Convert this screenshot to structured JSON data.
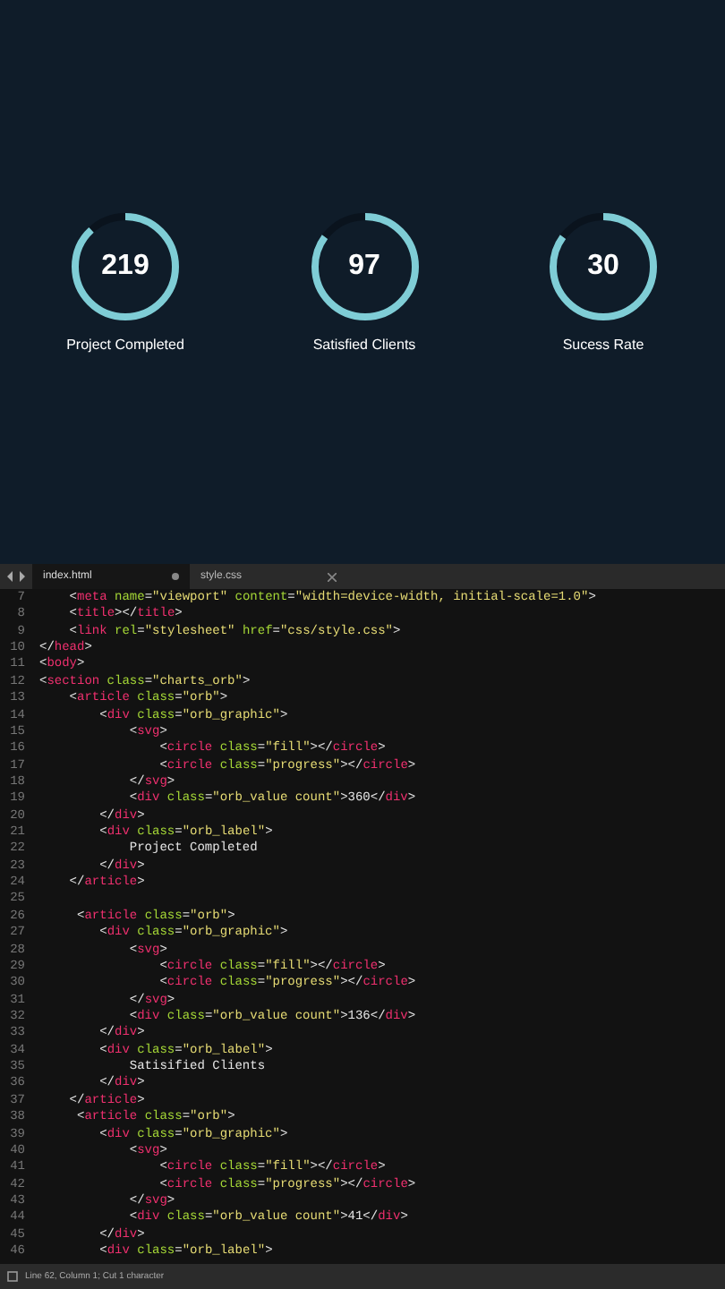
{
  "orbs": [
    {
      "value": "219",
      "label": "Project Completed",
      "level": 0.88
    },
    {
      "value": "97",
      "label": "Satisfied Clients",
      "level": 0.85
    },
    {
      "value": "30",
      "label": "Sucess Rate",
      "level": 0.85
    }
  ],
  "editor": {
    "tabs": [
      {
        "label": "index.html",
        "selected": true,
        "modified": true
      },
      {
        "label": "style.css",
        "selected": false,
        "modified": false
      }
    ],
    "lines": [
      {
        "number": "7",
        "tokens": [
          {
            "kind": "punct",
            "text": "    <"
          },
          {
            "kind": "tag",
            "text": "meta"
          },
          {
            "kind": "attr",
            "text": " name"
          },
          {
            "kind": "punct",
            "text": "="
          },
          {
            "kind": "string",
            "text": "\"viewport\""
          },
          {
            "kind": "attr",
            "text": " content"
          },
          {
            "kind": "punct",
            "text": "="
          },
          {
            "kind": "string",
            "text": "\"width=device-width, initial-scale=1.0\""
          },
          {
            "kind": "punct",
            "text": ">"
          }
        ]
      },
      {
        "number": "8",
        "tokens": [
          {
            "kind": "punct",
            "text": "    <"
          },
          {
            "kind": "tag",
            "text": "title"
          },
          {
            "kind": "punct",
            "text": "></"
          },
          {
            "kind": "tag",
            "text": "title"
          },
          {
            "kind": "punct",
            "text": ">"
          }
        ]
      },
      {
        "number": "9",
        "tokens": [
          {
            "kind": "punct",
            "text": "    <"
          },
          {
            "kind": "tag",
            "text": "link"
          },
          {
            "kind": "attr",
            "text": " rel"
          },
          {
            "kind": "punct",
            "text": "="
          },
          {
            "kind": "string",
            "text": "\"stylesheet\""
          },
          {
            "kind": "attr",
            "text": " href"
          },
          {
            "kind": "punct",
            "text": "="
          },
          {
            "kind": "string",
            "text": "\"css/style.css\""
          },
          {
            "kind": "punct",
            "text": ">"
          }
        ]
      },
      {
        "number": "10",
        "tokens": [
          {
            "kind": "punct",
            "text": "</"
          },
          {
            "kind": "tag",
            "text": "head"
          },
          {
            "kind": "punct",
            "text": ">"
          }
        ]
      },
      {
        "number": "11",
        "tokens": [
          {
            "kind": "punct",
            "text": "<"
          },
          {
            "kind": "tag",
            "text": "body"
          },
          {
            "kind": "punct",
            "text": ">"
          }
        ]
      },
      {
        "number": "12",
        "tokens": [
          {
            "kind": "punct",
            "text": "<"
          },
          {
            "kind": "tag",
            "text": "section"
          },
          {
            "kind": "attr",
            "text": " class"
          },
          {
            "kind": "punct",
            "text": "="
          },
          {
            "kind": "string",
            "text": "\"charts_orb\""
          },
          {
            "kind": "punct",
            "text": ">"
          }
        ]
      },
      {
        "number": "13",
        "tokens": [
          {
            "kind": "punct",
            "text": "    <"
          },
          {
            "kind": "tag",
            "text": "article"
          },
          {
            "kind": "attr",
            "text": " class"
          },
          {
            "kind": "punct",
            "text": "="
          },
          {
            "kind": "string",
            "text": "\"orb\""
          },
          {
            "kind": "punct",
            "text": ">"
          }
        ]
      },
      {
        "number": "14",
        "tokens": [
          {
            "kind": "punct",
            "text": "        <"
          },
          {
            "kind": "tag",
            "text": "div"
          },
          {
            "kind": "attr",
            "text": " class"
          },
          {
            "kind": "punct",
            "text": "="
          },
          {
            "kind": "string",
            "text": "\"orb_graphic\""
          },
          {
            "kind": "punct",
            "text": ">"
          }
        ]
      },
      {
        "number": "15",
        "tokens": [
          {
            "kind": "punct",
            "text": "            <"
          },
          {
            "kind": "tag",
            "text": "svg"
          },
          {
            "kind": "punct",
            "text": ">"
          }
        ]
      },
      {
        "number": "16",
        "tokens": [
          {
            "kind": "punct",
            "text": "                <"
          },
          {
            "kind": "tag",
            "text": "circle"
          },
          {
            "kind": "attr",
            "text": " class"
          },
          {
            "kind": "punct",
            "text": "="
          },
          {
            "kind": "string",
            "text": "\"fill\""
          },
          {
            "kind": "punct",
            "text": "></"
          },
          {
            "kind": "tag",
            "text": "circle"
          },
          {
            "kind": "punct",
            "text": ">"
          }
        ]
      },
      {
        "number": "17",
        "tokens": [
          {
            "kind": "punct",
            "text": "                <"
          },
          {
            "kind": "tag",
            "text": "circle"
          },
          {
            "kind": "attr",
            "text": " class"
          },
          {
            "kind": "punct",
            "text": "="
          },
          {
            "kind": "string",
            "text": "\"progress\""
          },
          {
            "kind": "punct",
            "text": "></"
          },
          {
            "kind": "tag",
            "text": "circle"
          },
          {
            "kind": "punct",
            "text": ">"
          }
        ]
      },
      {
        "number": "18",
        "tokens": [
          {
            "kind": "punct",
            "text": "            </"
          },
          {
            "kind": "tag",
            "text": "svg"
          },
          {
            "kind": "punct",
            "text": ">"
          }
        ]
      },
      {
        "number": "19",
        "tokens": [
          {
            "kind": "punct",
            "text": "            <"
          },
          {
            "kind": "tag",
            "text": "div"
          },
          {
            "kind": "attr",
            "text": " class"
          },
          {
            "kind": "punct",
            "text": "="
          },
          {
            "kind": "string",
            "text": "\"orb_value count\""
          },
          {
            "kind": "punct",
            "text": ">360</"
          },
          {
            "kind": "tag",
            "text": "div"
          },
          {
            "kind": "punct",
            "text": ">"
          }
        ]
      },
      {
        "number": "20",
        "tokens": [
          {
            "kind": "punct",
            "text": "        </"
          },
          {
            "kind": "tag",
            "text": "div"
          },
          {
            "kind": "punct",
            "text": ">"
          }
        ]
      },
      {
        "number": "21",
        "tokens": [
          {
            "kind": "punct",
            "text": "        <"
          },
          {
            "kind": "tag",
            "text": "div"
          },
          {
            "kind": "attr",
            "text": " class"
          },
          {
            "kind": "punct",
            "text": "="
          },
          {
            "kind": "string",
            "text": "\"orb_label\""
          },
          {
            "kind": "punct",
            "text": ">"
          }
        ]
      },
      {
        "number": "22",
        "tokens": [
          {
            "kind": "punct",
            "text": "            Project Completed"
          }
        ]
      },
      {
        "number": "23",
        "tokens": [
          {
            "kind": "punct",
            "text": "        </"
          },
          {
            "kind": "tag",
            "text": "div"
          },
          {
            "kind": "punct",
            "text": ">"
          }
        ]
      },
      {
        "number": "24",
        "tokens": [
          {
            "kind": "punct",
            "text": "    </"
          },
          {
            "kind": "tag",
            "text": "article"
          },
          {
            "kind": "punct",
            "text": ">"
          }
        ]
      },
      {
        "number": "25"
      },
      {
        "number": "26",
        "tokens": [
          {
            "kind": "punct",
            "text": "     <"
          },
          {
            "kind": "tag",
            "text": "article"
          },
          {
            "kind": "attr",
            "text": " class"
          },
          {
            "kind": "punct",
            "text": "="
          },
          {
            "kind": "string",
            "text": "\"orb\""
          },
          {
            "kind": "punct",
            "text": ">"
          }
        ]
      },
      {
        "number": "27",
        "tokens": [
          {
            "kind": "punct",
            "text": "        <"
          },
          {
            "kind": "tag",
            "text": "div"
          },
          {
            "kind": "attr",
            "text": " class"
          },
          {
            "kind": "punct",
            "text": "="
          },
          {
            "kind": "string",
            "text": "\"orb_graphic\""
          },
          {
            "kind": "punct",
            "text": ">"
          }
        ]
      },
      {
        "number": "28",
        "tokens": [
          {
            "kind": "punct",
            "text": "            <"
          },
          {
            "kind": "tag",
            "text": "svg"
          },
          {
            "kind": "punct",
            "text": ">"
          }
        ]
      },
      {
        "number": "29",
        "tokens": [
          {
            "kind": "punct",
            "text": "                <"
          },
          {
            "kind": "tag",
            "text": "circle"
          },
          {
            "kind": "attr",
            "text": " class"
          },
          {
            "kind": "punct",
            "text": "="
          },
          {
            "kind": "string",
            "text": "\"fill\""
          },
          {
            "kind": "punct",
            "text": "></"
          },
          {
            "kind": "tag",
            "text": "circle"
          },
          {
            "kind": "punct",
            "text": ">"
          }
        ]
      },
      {
        "number": "30",
        "tokens": [
          {
            "kind": "punct",
            "text": "                <"
          },
          {
            "kind": "tag",
            "text": "circle"
          },
          {
            "kind": "attr",
            "text": " class"
          },
          {
            "kind": "punct",
            "text": "="
          },
          {
            "kind": "string",
            "text": "\"progress\""
          },
          {
            "kind": "punct",
            "text": "></"
          },
          {
            "kind": "tag",
            "text": "circle"
          },
          {
            "kind": "punct",
            "text": ">"
          }
        ]
      },
      {
        "number": "31",
        "tokens": [
          {
            "kind": "punct",
            "text": "            </"
          },
          {
            "kind": "tag",
            "text": "svg"
          },
          {
            "kind": "punct",
            "text": ">"
          }
        ]
      },
      {
        "number": "32",
        "tokens": [
          {
            "kind": "punct",
            "text": "            <"
          },
          {
            "kind": "tag",
            "text": "div"
          },
          {
            "kind": "attr",
            "text": " class"
          },
          {
            "kind": "punct",
            "text": "="
          },
          {
            "kind": "string",
            "text": "\"orb_value count\""
          },
          {
            "kind": "punct",
            "text": ">136</"
          },
          {
            "kind": "tag",
            "text": "div"
          },
          {
            "kind": "punct",
            "text": ">"
          }
        ]
      },
      {
        "number": "33",
        "tokens": [
          {
            "kind": "punct",
            "text": "        </"
          },
          {
            "kind": "tag",
            "text": "div"
          },
          {
            "kind": "punct",
            "text": ">"
          }
        ]
      },
      {
        "number": "34",
        "tokens": [
          {
            "kind": "punct",
            "text": "        <"
          },
          {
            "kind": "tag",
            "text": "div"
          },
          {
            "kind": "attr",
            "text": " class"
          },
          {
            "kind": "punct",
            "text": "="
          },
          {
            "kind": "string",
            "text": "\"orb_label\""
          },
          {
            "kind": "punct",
            "text": ">"
          }
        ]
      },
      {
        "number": "35",
        "tokens": [
          {
            "kind": "punct",
            "text": "            Satisified Clients"
          }
        ]
      },
      {
        "number": "36",
        "tokens": [
          {
            "kind": "punct",
            "text": "        </"
          },
          {
            "kind": "tag",
            "text": "div"
          },
          {
            "kind": "punct",
            "text": ">"
          }
        ]
      },
      {
        "number": "37",
        "tokens": [
          {
            "kind": "punct",
            "text": "    </"
          },
          {
            "kind": "tag",
            "text": "article"
          },
          {
            "kind": "punct",
            "text": ">"
          }
        ]
      },
      {
        "number": "38",
        "tokens": [
          {
            "kind": "punct",
            "text": "     <"
          },
          {
            "kind": "tag",
            "text": "article"
          },
          {
            "kind": "attr",
            "text": " class"
          },
          {
            "kind": "punct",
            "text": "="
          },
          {
            "kind": "string",
            "text": "\"orb\""
          },
          {
            "kind": "punct",
            "text": ">"
          }
        ]
      },
      {
        "number": "39",
        "tokens": [
          {
            "kind": "punct",
            "text": "        <"
          },
          {
            "kind": "tag",
            "text": "div"
          },
          {
            "kind": "attr",
            "text": " class"
          },
          {
            "kind": "punct",
            "text": "="
          },
          {
            "kind": "string",
            "text": "\"orb_graphic\""
          },
          {
            "kind": "punct",
            "text": ">"
          }
        ]
      },
      {
        "number": "40",
        "tokens": [
          {
            "kind": "punct",
            "text": "            <"
          },
          {
            "kind": "tag",
            "text": "svg"
          },
          {
            "kind": "punct",
            "text": ">"
          }
        ]
      },
      {
        "number": "41",
        "tokens": [
          {
            "kind": "punct",
            "text": "                <"
          },
          {
            "kind": "tag",
            "text": "circle"
          },
          {
            "kind": "attr",
            "text": " class"
          },
          {
            "kind": "punct",
            "text": "="
          },
          {
            "kind": "string",
            "text": "\"fill\""
          },
          {
            "kind": "punct",
            "text": "></"
          },
          {
            "kind": "tag",
            "text": "circle"
          },
          {
            "kind": "punct",
            "text": ">"
          }
        ]
      },
      {
        "number": "42",
        "tokens": [
          {
            "kind": "punct",
            "text": "                <"
          },
          {
            "kind": "tag",
            "text": "circle"
          },
          {
            "kind": "attr",
            "text": " class"
          },
          {
            "kind": "punct",
            "text": "="
          },
          {
            "kind": "string",
            "text": "\"progress\""
          },
          {
            "kind": "punct",
            "text": "></"
          },
          {
            "kind": "tag",
            "text": "circle"
          },
          {
            "kind": "punct",
            "text": ">"
          }
        ]
      },
      {
        "number": "43",
        "tokens": [
          {
            "kind": "punct",
            "text": "            </"
          },
          {
            "kind": "tag",
            "text": "svg"
          },
          {
            "kind": "punct",
            "text": ">"
          }
        ]
      },
      {
        "number": "44",
        "tokens": [
          {
            "kind": "punct",
            "text": "            <"
          },
          {
            "kind": "tag",
            "text": "div"
          },
          {
            "kind": "attr",
            "text": " class"
          },
          {
            "kind": "punct",
            "text": "="
          },
          {
            "kind": "string",
            "text": "\"orb_value count\""
          },
          {
            "kind": "punct",
            "text": ">41</"
          },
          {
            "kind": "tag",
            "text": "div"
          },
          {
            "kind": "punct",
            "text": ">"
          }
        ]
      },
      {
        "number": "45",
        "tokens": [
          {
            "kind": "punct",
            "text": "        </"
          },
          {
            "kind": "tag",
            "text": "div"
          },
          {
            "kind": "punct",
            "text": ">"
          }
        ]
      },
      {
        "number": "46",
        "tokens": [
          {
            "kind": "punct",
            "text": "        <"
          },
          {
            "kind": "tag",
            "text": "div"
          },
          {
            "kind": "attr",
            "text": " class"
          },
          {
            "kind": "punct",
            "text": "="
          },
          {
            "kind": "string",
            "text": "\"orb_label\""
          },
          {
            "kind": "punct",
            "text": ">"
          }
        ]
      }
    ],
    "status_bar": "Line 62, Column 1; Cut 1 character"
  }
}
